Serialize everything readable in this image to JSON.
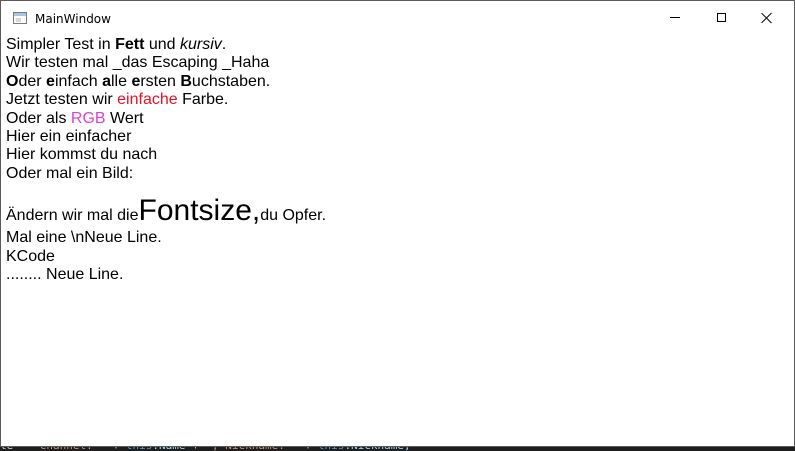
{
  "window": {
    "title": "MainWindow"
  },
  "content": {
    "line1": {
      "prefix": "Simpler Test in ",
      "bold": "Fett",
      "middle": " und ",
      "italic": "kursiv",
      "suffix": "."
    },
    "line2": "Wir testen mal _das Escaping _Haha",
    "line3": {
      "segments": [
        {
          "text": "O",
          "bold": true
        },
        {
          "text": "der ",
          "bold": false
        },
        {
          "text": "e",
          "bold": true
        },
        {
          "text": "infach ",
          "bold": false
        },
        {
          "text": "a",
          "bold": true
        },
        {
          "text": "lle ",
          "bold": false
        },
        {
          "text": "e",
          "bold": true
        },
        {
          "text": "rsten ",
          "bold": false
        },
        {
          "text": "B",
          "bold": true
        },
        {
          "text": "uchstaben.",
          "bold": false
        }
      ]
    },
    "line4": {
      "prefix": "Jetzt testen wir ",
      "colored": "einfache",
      "suffix": " Farbe.",
      "color": "#e81123"
    },
    "line5": {
      "prefix": "Oder als ",
      "colored": "RGB",
      "suffix": " Wert",
      "color": "#e040d0"
    },
    "line6": "Hier ein einfacher",
    "line7": "Hier kommst du nach",
    "line8": "Oder mal ein Bild:",
    "line9": {
      "prefix": "Ändern wir mal die ",
      "big": "Fontsize,",
      "suffix": " du Opfer."
    },
    "line10": "Mal eine \\nNeue Line.",
    "line11": "KCode",
    "line12": "........ Neue Line."
  },
  "background_code": {
    "seg1": "le = ",
    "seg2": "\"Channel: \"",
    "seg3": " + ",
    "seg4": "this",
    "seg5": ".Name + ",
    "seg6": "\", Nickname: \"",
    "seg7": " + ",
    "seg8": "this",
    "seg9": ".Nickname;"
  }
}
